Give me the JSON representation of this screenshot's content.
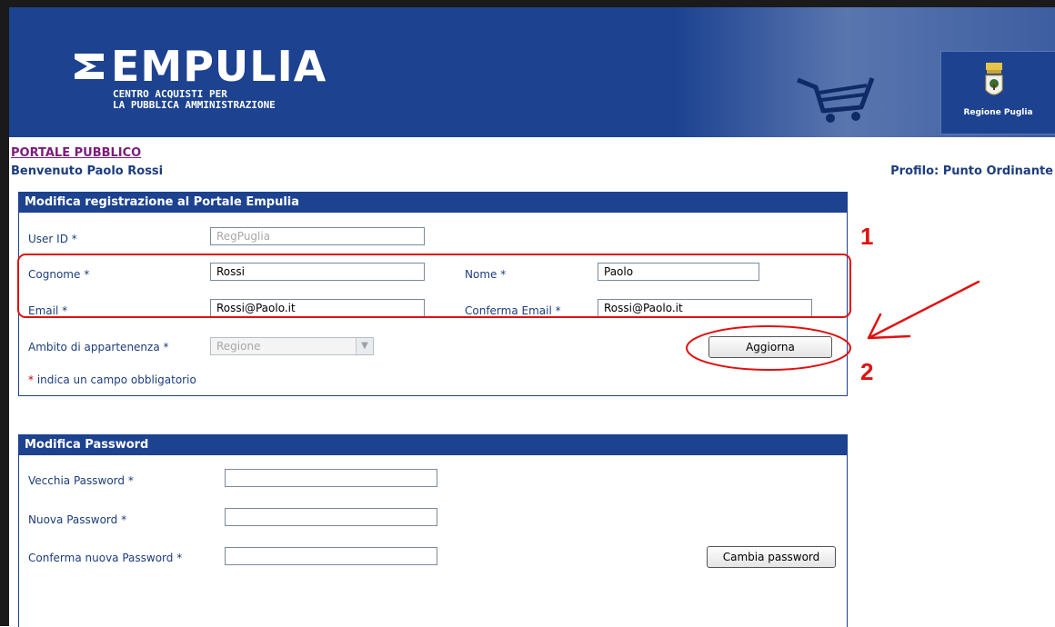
{
  "header": {
    "logo_title": "EMPULIA",
    "logo_sub_line1": "CENTRO ACQUISTI PER",
    "logo_sub_line2": "LA PUBBLICA AMMINISTRAZIONE",
    "region_label": "Regione Puglia"
  },
  "nav": {
    "portal_link": "PORTALE PUBBLICO",
    "welcome": "Benvenuto Paolo Rossi",
    "profile": "Profilo: Punto Ordinante"
  },
  "registration": {
    "title": "Modifica registrazione al Portale Empulia",
    "userid_label": "User ID",
    "userid_value": "RegPuglia",
    "cognome_label": "Cognome",
    "cognome_value": "Rossi",
    "nome_label": "Nome",
    "nome_value": "Paolo",
    "email_label": "Email",
    "email_value": "Rossi@Paolo.it",
    "conferma_email_label": "Conferma Email",
    "conferma_email_value": "Rossi@Paolo.it",
    "ambito_label": "Ambito di appartenenza",
    "ambito_value": "Regione",
    "update_button": "Aggiorna",
    "required_star": "*",
    "required_note": "indica un campo obbligatorio"
  },
  "password": {
    "title": "Modifica Password",
    "old_label": "Vecchia Password",
    "new_label": "Nuova Password",
    "confirm_label": "Conferma nuova Password",
    "change_button": "Cambia password"
  },
  "annotations": {
    "marker_1": "1",
    "marker_2": "2",
    "color": "#e01010"
  },
  "colors": {
    "brand_blue": "#1c4290",
    "label_blue": "#1c3d7e",
    "link_purple": "#7b1c7b",
    "required_red": "#c00000"
  }
}
